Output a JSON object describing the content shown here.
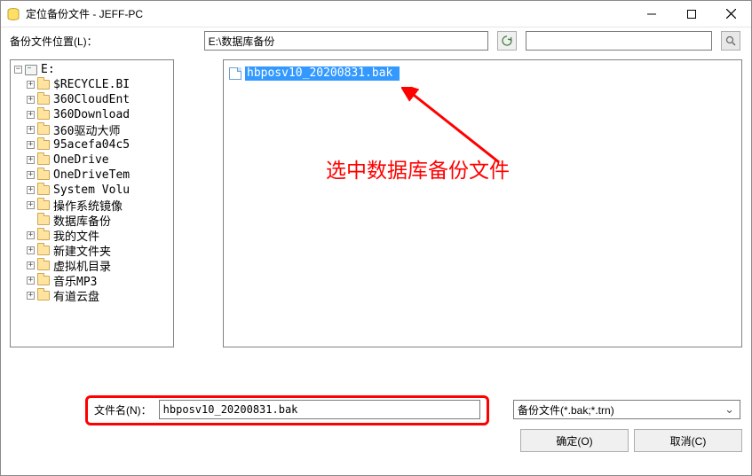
{
  "window": {
    "title": "定位备份文件 - JEFF-PC"
  },
  "toolbar": {
    "location_label": "备份文件位置(L)：",
    "path_value": "E:\\数据库备份"
  },
  "tree": {
    "root": {
      "label": "E:"
    },
    "items": [
      {
        "label": "$RECYCLE.BI"
      },
      {
        "label": "360CloudEnt"
      },
      {
        "label": "360Download"
      },
      {
        "label": "360驱动大师"
      },
      {
        "label": "95acefa04c5"
      },
      {
        "label": "OneDrive"
      },
      {
        "label": "OneDriveTem"
      },
      {
        "label": "System Volu"
      },
      {
        "label": "操作系统镜像"
      },
      {
        "label": "数据库备份"
      },
      {
        "label": "我的文件"
      },
      {
        "label": "新建文件夹"
      },
      {
        "label": "虚拟机目录"
      },
      {
        "label": "音乐MP3"
      },
      {
        "label": "有道云盘"
      }
    ]
  },
  "file_list": {
    "selected": "hbposv10_20200831.bak"
  },
  "annotation": {
    "text": "选中数据库备份文件"
  },
  "filename": {
    "label": "文件名(N)：",
    "value": "hbposv10_20200831.bak"
  },
  "filetype": {
    "selected": "备份文件(*.bak;*.trn)"
  },
  "buttons": {
    "ok": "确定(O)",
    "cancel": "取消(C)"
  }
}
